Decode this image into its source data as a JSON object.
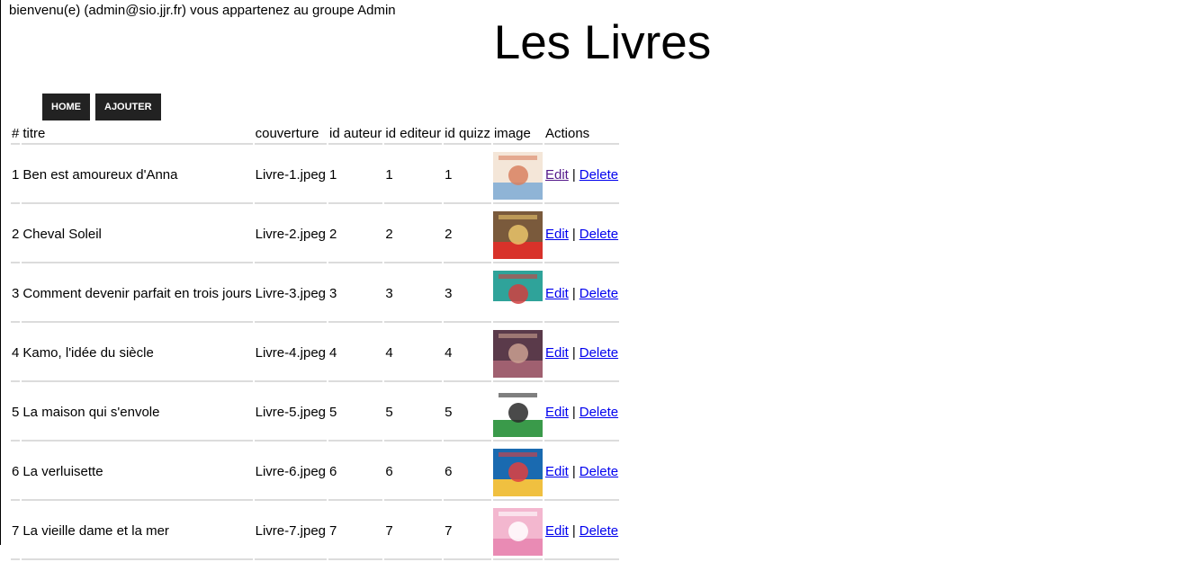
{
  "header": {
    "welcome": "bienvenu(e) (admin@sio.jjr.fr) vous appartenez au groupe Admin",
    "title": "Les Livres"
  },
  "nav": {
    "home": "HOME",
    "add": "AJOUTER"
  },
  "table": {
    "headers": [
      "#",
      "titre",
      "couverture",
      "id auteur",
      "id editeur",
      "id quizz",
      "image",
      "Actions"
    ],
    "rows": [
      {
        "id": "1",
        "titre": "Ben est amoureux d'Anna",
        "couverture": "Livre-1.jpeg",
        "auteur": "1",
        "editeur": "1",
        "quizz": "1"
      },
      {
        "id": "2",
        "titre": "Cheval Soleil",
        "couverture": "Livre-2.jpeg",
        "auteur": "2",
        "editeur": "2",
        "quizz": "2"
      },
      {
        "id": "3",
        "titre": "Comment devenir parfait en trois jours",
        "couverture": "Livre-3.jpeg",
        "auteur": "3",
        "editeur": "3",
        "quizz": "3"
      },
      {
        "id": "4",
        "titre": "Kamo, l'idée du siècle",
        "couverture": "Livre-4.jpeg",
        "auteur": "4",
        "editeur": "4",
        "quizz": "4"
      },
      {
        "id": "5",
        "titre": "La maison qui s'envole",
        "couverture": "Livre-5.jpeg",
        "auteur": "5",
        "editeur": "5",
        "quizz": "5"
      },
      {
        "id": "6",
        "titre": "La verluisette",
        "couverture": "Livre-6.jpeg",
        "auteur": "6",
        "editeur": "6",
        "quizz": "6"
      },
      {
        "id": "7",
        "titre": "La vieille dame et la mer",
        "couverture": "Livre-7.jpeg",
        "auteur": "7",
        "editeur": "7",
        "quizz": "7"
      }
    ],
    "edit_label": "Edit",
    "separator": "|",
    "delete_label": "Delete"
  }
}
